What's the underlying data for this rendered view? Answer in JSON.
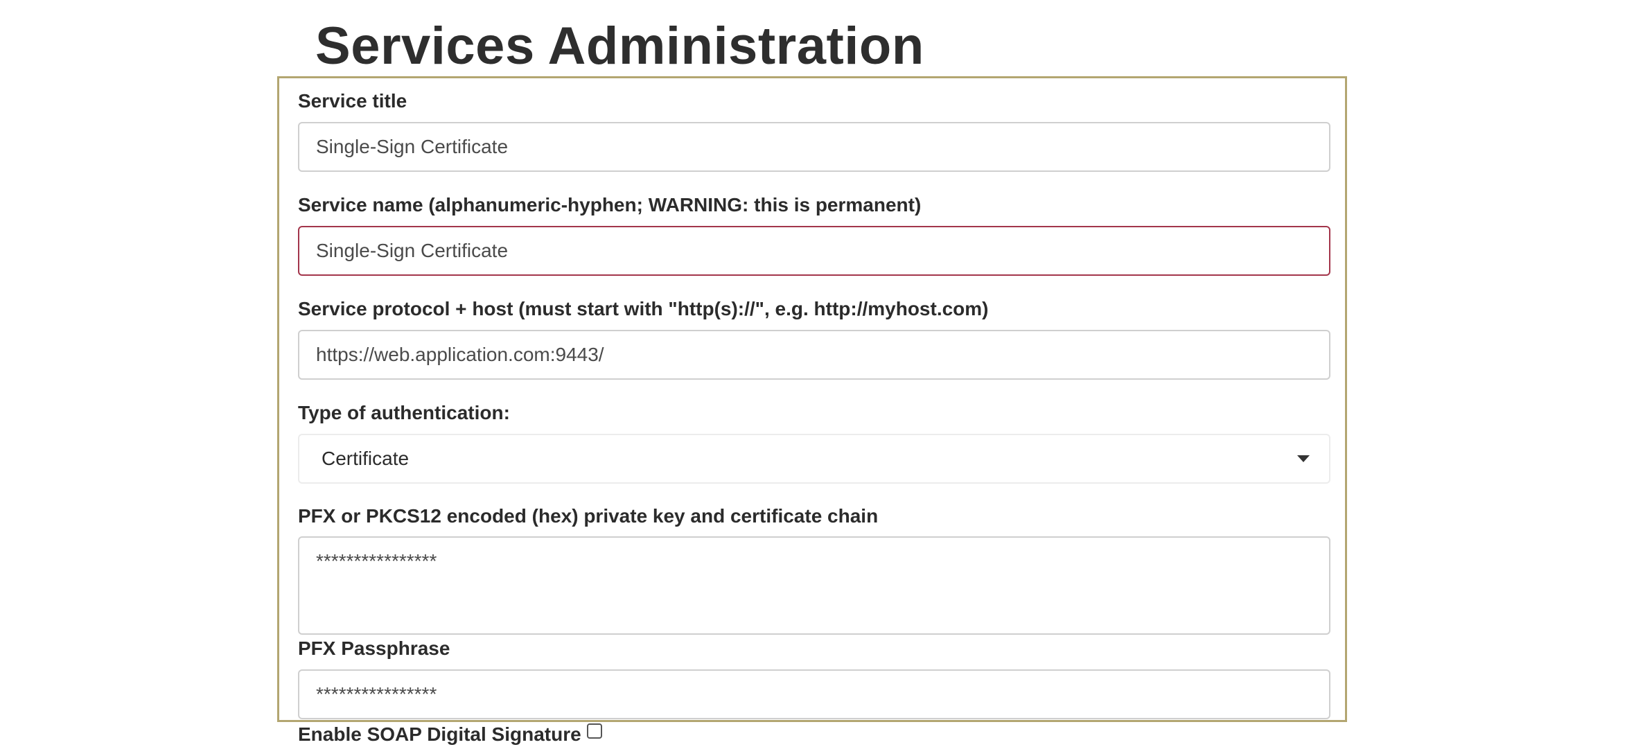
{
  "page": {
    "title": "Services Administration"
  },
  "form": {
    "service_title": {
      "label": "Service title",
      "value": "Single-Sign Certificate"
    },
    "service_name": {
      "label": "Service name (alphanumeric-hyphen; WARNING: this is permanent)",
      "value": "Single-Sign Certificate"
    },
    "service_host": {
      "label": "Service protocol + host (must start with \"http(s)://\", e.g. http://myhost.com)",
      "value": "https://web.application.com:9443/"
    },
    "auth_type": {
      "label": "Type of authentication:",
      "selected": "Certificate"
    },
    "pfx_key": {
      "label": "PFX or PKCS12 encoded (hex) private key and certificate chain",
      "value": "****************"
    },
    "pfx_passphrase": {
      "label": "PFX Passphrase",
      "value": "****************"
    },
    "soap_signature": {
      "label": "Enable SOAP Digital Signature",
      "checked": false
    }
  },
  "colors": {
    "panel_border": "#b3a671",
    "invalid_border": "#a3354b",
    "input_border": "#cfcfcf"
  }
}
